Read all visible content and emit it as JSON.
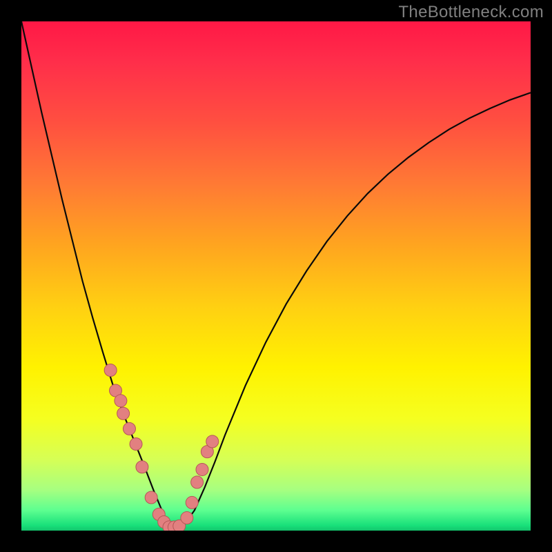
{
  "watermark": "TheBottleneck.com",
  "colors": {
    "frame_bg": "#000000",
    "curve": "#0a0a0a",
    "dot_fill": "#e28080",
    "dot_stroke": "#b55757",
    "gradient_stops": [
      "#ff1846",
      "#ff2e4a",
      "#ff5040",
      "#ff7a34",
      "#ffa51f",
      "#ffd012",
      "#fff200",
      "#f5ff20",
      "#d6ff55",
      "#a7ff80",
      "#5dff90",
      "#18e07a",
      "#13c46c"
    ]
  },
  "chart_data": {
    "type": "line",
    "title": "",
    "xlabel": "",
    "ylabel": "",
    "xlim": [
      0,
      100
    ],
    "ylim": [
      0,
      100
    ],
    "series": [
      {
        "name": "curve",
        "x": [
          0,
          2,
          4,
          6,
          8,
          10,
          12,
          14,
          16,
          18,
          20,
          22,
          24,
          26,
          28,
          28.5,
          29,
          30,
          32,
          34,
          36,
          38,
          40,
          44,
          48,
          52,
          56,
          60,
          64,
          68,
          72,
          76,
          80,
          84,
          88,
          92,
          96,
          100
        ],
        "y": [
          100,
          91,
          82,
          73.5,
          65,
          57,
          49,
          41.8,
          35,
          28.5,
          23,
          18,
          13,
          7.8,
          3,
          1.7,
          0.7,
          0.5,
          1.2,
          4,
          8.5,
          13.5,
          18.8,
          28.5,
          37,
          44.5,
          51,
          56.8,
          61.8,
          66.2,
          70,
          73.3,
          76.2,
          78.8,
          81,
          82.9,
          84.6,
          86
        ]
      },
      {
        "name": "dots",
        "x": [
          17.5,
          18.5,
          19.5,
          20.0,
          21.2,
          22.5,
          23.7,
          25.5,
          27.0,
          28.0,
          29.0,
          30.0,
          31.0,
          32.5,
          33.5,
          34.5,
          35.5,
          36.5,
          37.5
        ],
        "y": [
          31.5,
          27.5,
          25.5,
          23.0,
          20.0,
          17.0,
          12.5,
          6.5,
          3.2,
          1.7,
          0.7,
          0.7,
          0.9,
          2.5,
          5.5,
          9.5,
          12.0,
          15.5,
          17.5
        ]
      }
    ]
  }
}
